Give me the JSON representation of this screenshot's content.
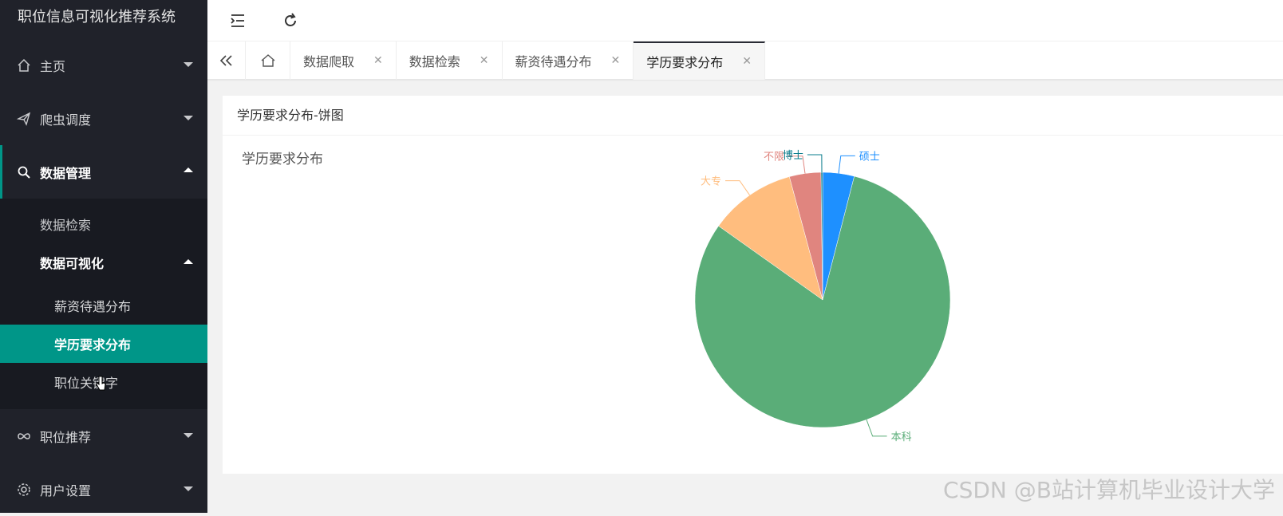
{
  "app": {
    "title": "职位信息可视化推荐系统"
  },
  "sidebar": {
    "items": [
      {
        "label": "主页",
        "icon": "home-icon"
      },
      {
        "label": "爬虫调度",
        "icon": "send-icon"
      },
      {
        "label": "数据管理",
        "icon": "search-icon"
      },
      {
        "label": "职位推荐",
        "icon": "infinity-icon"
      },
      {
        "label": "用户设置",
        "icon": "gear-icon"
      }
    ],
    "data_mgmt_sub": [
      {
        "label": "数据检索"
      },
      {
        "label": "数据可视化"
      }
    ],
    "viz_sub": [
      {
        "label": "薪资待遇分布"
      },
      {
        "label": "学历要求分布"
      },
      {
        "label": "职位关键字"
      }
    ]
  },
  "tabs": [
    {
      "label": "数据爬取"
    },
    {
      "label": "数据检索"
    },
    {
      "label": "薪资待遇分布"
    },
    {
      "label": "学历要求分布"
    }
  ],
  "card": {
    "title": "学历要求分布-饼图"
  },
  "chart_data": {
    "type": "pie",
    "title": "学历要求分布",
    "categories": [
      "硕士",
      "本科",
      "大专",
      "不限",
      "博士"
    ],
    "values": [
      4,
      81,
      11,
      4,
      0.2
    ],
    "colors": [
      "#1e90ff",
      "#5aad78",
      "#ffbd7e",
      "#e0857f",
      "#0a7c8c"
    ]
  },
  "watermark": "CSDN @B站计算机毕业设计大学"
}
